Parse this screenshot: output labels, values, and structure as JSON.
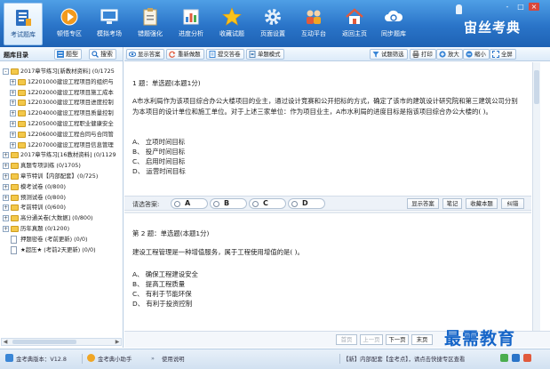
{
  "nav": {
    "items": [
      {
        "label": "考试题库",
        "icon": "question-bank-icon"
      },
      {
        "label": "顿悟专区",
        "icon": "play-circle-icon"
      },
      {
        "label": "模拟考场",
        "icon": "monitor-icon"
      },
      {
        "label": "错题强化",
        "icon": "clipboard-icon"
      },
      {
        "label": "进度分析",
        "icon": "bar-chart-icon"
      },
      {
        "label": "收藏试题",
        "icon": "star-icon"
      },
      {
        "label": "页面设置",
        "icon": "gear-icon"
      },
      {
        "label": "互动平台",
        "icon": "people-icon"
      },
      {
        "label": "返回主页",
        "icon": "home-icon"
      },
      {
        "label": "同步题库",
        "icon": "sync-cloud-icon"
      }
    ],
    "brand": "宙丝考典",
    "window_controls": [
      "-",
      "□",
      "×"
    ]
  },
  "left": {
    "title": "题库目录",
    "tab_type": "题型",
    "tab_search": "搜索",
    "tree": [
      {
        "label": "2017章节练习[新教材资料] (0/1725",
        "level": 0,
        "expander": "-",
        "icon": "folder"
      },
      {
        "label": "1Z201000建设工程项目的组织与",
        "level": 1,
        "expander": "+",
        "icon": "folder"
      },
      {
        "label": "1Z202000建设工程项目施工成本",
        "level": 1,
        "expander": "+",
        "icon": "folder"
      },
      {
        "label": "1Z203000建设工程项目进度控制",
        "level": 1,
        "expander": "+",
        "icon": "folder"
      },
      {
        "label": "1Z204000建设工程项目质量控制",
        "level": 1,
        "expander": "+",
        "icon": "folder"
      },
      {
        "label": "1Z205000建设工程职业健康安全",
        "level": 1,
        "expander": "+",
        "icon": "folder"
      },
      {
        "label": "1Z206000建设工程合同与合同管",
        "level": 1,
        "expander": "+",
        "icon": "folder"
      },
      {
        "label": "1Z207000建设工程项目信息管理",
        "level": 1,
        "expander": "+",
        "icon": "folder"
      },
      {
        "label": "2017章节练习[16教材资料] (0/1129",
        "level": 0,
        "expander": "+",
        "icon": "folder"
      },
      {
        "label": "真题专项训练 (0/1705)",
        "level": 0,
        "expander": "+",
        "icon": "folder"
      },
      {
        "label": "章节特训【内部配套】(0/725)",
        "level": 0,
        "expander": "+",
        "icon": "folder"
      },
      {
        "label": "模考试卷 (0/800)",
        "level": 0,
        "expander": "+",
        "icon": "folder"
      },
      {
        "label": "预测试卷 (0/800)",
        "level": 0,
        "expander": "+",
        "icon": "folder"
      },
      {
        "label": "考前特训 (0/600)",
        "level": 0,
        "expander": "+",
        "icon": "folder"
      },
      {
        "label": "高分通关卷[大数据] (0/800)",
        "level": 0,
        "expander": "+",
        "icon": "folder"
      },
      {
        "label": "历年真题 (0/1200)",
        "level": 0,
        "expander": "+",
        "icon": "folder"
      },
      {
        "label": "押题密卷 (考前更新) (0/0)",
        "level": 0,
        "expander": "",
        "icon": "doc"
      },
      {
        "label": "★超压★ (考前2天更新) (0/0)",
        "level": 0,
        "expander": "",
        "icon": "doc"
      }
    ]
  },
  "toolbar": {
    "show_answer": "显示答案",
    "redo": "重新做题",
    "submit": "提交答卷",
    "single_mode": "单题模式",
    "filter": "试题筛选",
    "print": "打印",
    "zoom_in": "放大",
    "zoom_out": "缩小",
    "fullscreen": "全屏"
  },
  "q1": {
    "title": "1 题：单选题(本题1分)",
    "text": "A市水利局作为该项目综合办公大楼项目的业主，通过设计竞赛和公开招标的方式，确定了该市的建筑设计研究院和第三建筑公司分别为本项目的设计单位和施工单位。对于上述三家单位：作为项目业主，A市水利局的进度目标是指该项目综合办公大楼的( )。",
    "options": [
      "A、 立项时间目标",
      "B、 投产时间目标",
      "C、 启用时间目标",
      "D、 运营时间目标"
    ]
  },
  "answer_bar": {
    "label": "请选答案:",
    "choices": [
      "A",
      "B",
      "C",
      "D"
    ],
    "show_answer": "显示答案",
    "note": "笔记",
    "favorite": "收藏本题",
    "error": "纠错"
  },
  "q2": {
    "title": "第 2 题：单选题(本题1分)",
    "text": "建设工程管理是一种增值服务，属于工程使用增值的是( )。",
    "options": [
      "A、 确保工程建设安全",
      "B、 提高工程质量",
      "C、 有利于节能环保",
      "D、 有利于投资控制"
    ]
  },
  "pager": {
    "first": "首页",
    "prev": "上一页",
    "next": "下一页",
    "last": "末页"
  },
  "watermark": "最需教育",
  "status": {
    "version": "金考典版本：V12.8",
    "helper": "金考典小助手",
    "guide": "使用说明",
    "notice": "【新】内部配套【金考点】，请点击快捷专区查看"
  },
  "colors": {
    "header_top": "#4f9fe6",
    "header_bottom": "#1e62b4",
    "panel_border": "#b8cde3",
    "answer_bar_bg": "#edf2f8",
    "watermark": "#1565c8"
  }
}
